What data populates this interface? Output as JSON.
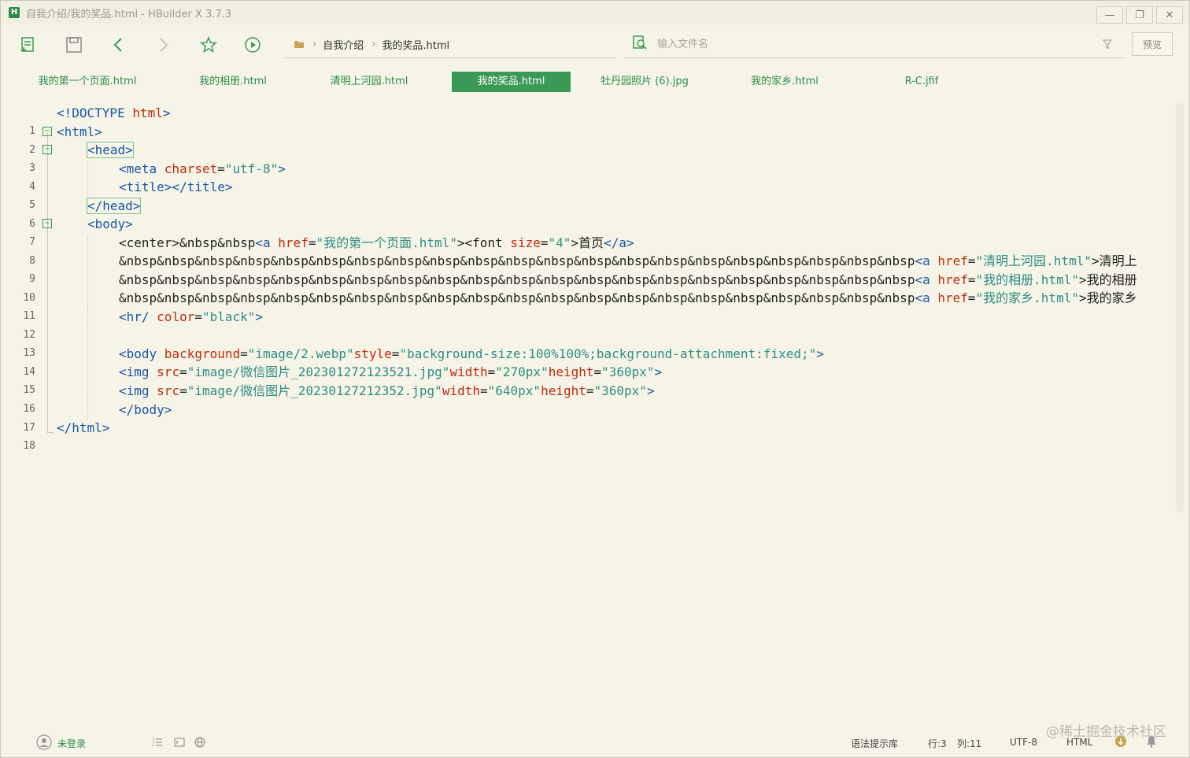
{
  "window": {
    "title": "自我介绍/我的奖品.html - HBuilder X 3.7.3",
    "logo_letter": "H",
    "minimize": "—",
    "restore": "❐",
    "close": "✕"
  },
  "toolbar": {
    "breadcrumb": [
      "自我介绍",
      "我的奖品.html"
    ],
    "search_placeholder": "输入文件名",
    "preview_label": "预览"
  },
  "tabs": [
    {
      "label": "我的第一个页面.html",
      "active": false
    },
    {
      "label": "我的相册.html",
      "active": false
    },
    {
      "label": "清明上河园.html",
      "active": false
    },
    {
      "label": "我的奖品.html",
      "active": true
    },
    {
      "label": "牡丹园照片 (6).jpg",
      "active": false
    },
    {
      "label": "我的家乡.html",
      "active": false
    },
    {
      "label": "R-C.jfif",
      "active": false
    }
  ],
  "code": {
    "line_numbers": [
      "1",
      "2",
      "3",
      "4",
      "5",
      "6",
      "7",
      "8",
      "9",
      "10",
      "11",
      "12",
      "13",
      "14",
      "15",
      "16",
      "17",
      "18"
    ],
    "l1": [
      "<!DOCTYPE ",
      "html",
      ">"
    ],
    "l2": [
      "<html>"
    ],
    "l3": [
      "<head>"
    ],
    "l4": [
      "<meta ",
      "charset",
      "=",
      "\"utf-8\"",
      ">"
    ],
    "l5": [
      "<title></title>"
    ],
    "l6": [
      "</head>"
    ],
    "l7": [
      "<body>"
    ],
    "l8": [
      "<center>&nbsp&nbsp",
      "<a ",
      "href",
      "=",
      "\"我的第一个页面.html\"",
      "><font ",
      "size",
      "=",
      "\"4\"",
      ">首页",
      "</a>"
    ],
    "l9": [
      "&nbsp&nbsp&nbsp&nbsp&nbsp&nbsp&nbsp&nbsp&nbsp&nbsp&nbsp&nbsp&nbsp&nbsp&nbsp&nbsp&nbsp&nbsp&nbsp&nbsp&nbsp",
      "<a ",
      "href",
      "=",
      "\"清明上河园.html\"",
      ">清明上"
    ],
    "l10": [
      "&nbsp&nbsp&nbsp&nbsp&nbsp&nbsp&nbsp&nbsp&nbsp&nbsp&nbsp&nbsp&nbsp&nbsp&nbsp&nbsp&nbsp&nbsp&nbsp&nbsp&nbsp",
      "<a ",
      "href",
      "=",
      "\"我的相册.html\"",
      ">我的相册"
    ],
    "l11": [
      "&nbsp&nbsp&nbsp&nbsp&nbsp&nbsp&nbsp&nbsp&nbsp&nbsp&nbsp&nbsp&nbsp&nbsp&nbsp&nbsp&nbsp&nbsp&nbsp&nbsp&nbsp",
      "<a ",
      "href",
      "=",
      "\"我的家乡.html\"",
      ">我的家乡"
    ],
    "l12": [
      "<hr/ ",
      "color",
      "=",
      "\"black\"",
      ">"
    ],
    "l14": [
      "<body ",
      "background",
      "=",
      "\"image/2.webp\"",
      "style",
      "=",
      "\"background-size:100%100%;background-attachment:fixed;\"",
      ">"
    ],
    "l15": [
      "<img ",
      "src",
      "=",
      "\"image/微信图片_202301272123521.jpg\"",
      "width",
      "=",
      "\"270px\"",
      "height",
      "=",
      "\"360px\"",
      ">"
    ],
    "l16": [
      "<img ",
      "src",
      "=",
      "\"image/微信图片_20230127212352.jpg\"",
      "width",
      "=",
      "\"640px\"",
      "height",
      "=",
      "\"360px\"",
      ">"
    ],
    "l17": [
      "</body>"
    ],
    "l18": [
      "</html>"
    ]
  },
  "statusbar": {
    "login": "未登录",
    "syntax_lib": "语法提示库",
    "row": "行:3",
    "col": "列:11",
    "encoding": "UTF-8",
    "language": "HTML"
  },
  "watermark": "@稀土掘金技术社区",
  "colors": {
    "accent_green": "#3a9a55",
    "tag_blue": "#1a55a8",
    "attr_red": "#c22a0e",
    "string_teal": "#2e8d84",
    "background": "#f5f4e6"
  }
}
